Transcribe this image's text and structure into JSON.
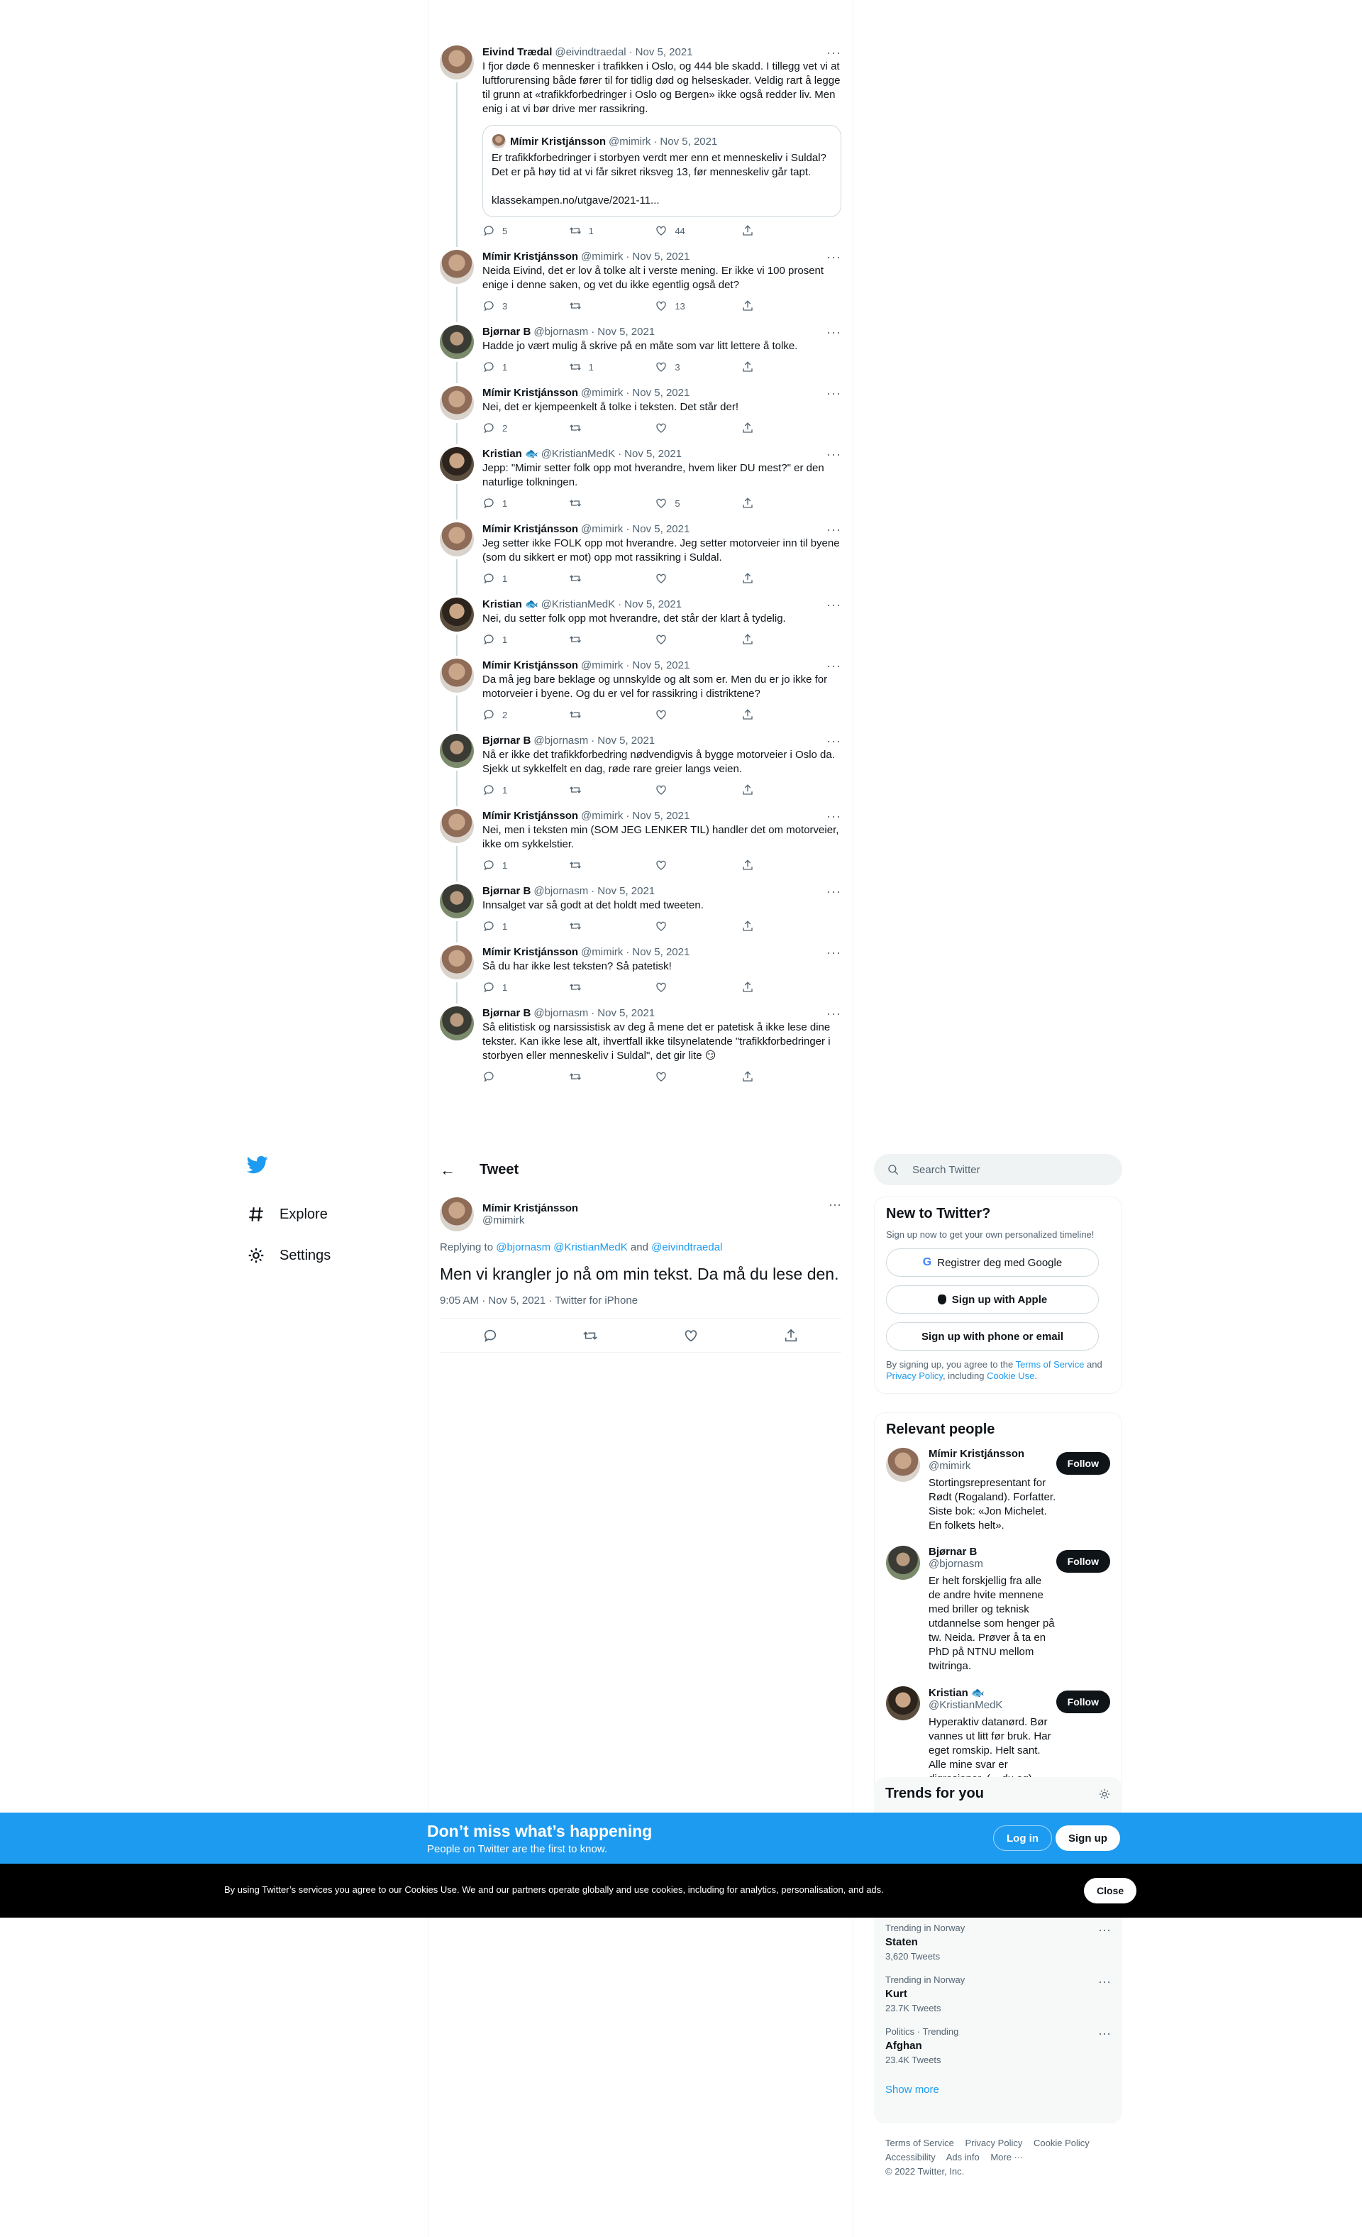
{
  "thread": [
    {
      "name": "Eivind Trædal",
      "handle": "@eivindtraedal",
      "date": "Nov 5, 2021",
      "text": "I fjor døde 6 mennesker i trafikken i Oslo, og 444 ble skadd. I tillegg vet vi at luftforurensing både fører til for tidlig død og helseskader. Veldig rart å legge til grunn at «trafikkforbedringer i Oslo og Bergen» ikke også redder liv. Men enig i at vi bør drive mer rassikring.",
      "quote": {
        "name": "Mímir Kristjánsson",
        "handle": "@mimirk",
        "date": "Nov 5, 2021",
        "text": "Er trafikkforbedringer i storbyen verdt mer enn et menneskeliv i Suldal? Det er på høy tid at vi får sikret riksveg 13, før menneskeliv går tapt.\n\nklassekampen.no/utgave/2021-11..."
      },
      "replies": "5",
      "retweets": "1",
      "likes": "44"
    },
    {
      "name": "Mímir Kristjánsson",
      "handle": "@mimirk",
      "date": "Nov 5, 2021",
      "text": "Neida Eivind, det er lov å tolke alt i verste mening. Er ikke vi 100 prosent enige i denne saken, og vet du ikke egentlig også det?",
      "replies": "3",
      "retweets": "",
      "likes": "13"
    },
    {
      "name": "Bjørnar B",
      "handle": "@bjornasm",
      "date": "Nov 5, 2021",
      "text": "Hadde jo vært mulig å skrive på en måte som var litt lettere å tolke.",
      "replies": "1",
      "retweets": "1",
      "likes": "3"
    },
    {
      "name": "Mímir Kristjánsson",
      "handle": "@mimirk",
      "date": "Nov 5, 2021",
      "text": "Nei, det er kjempeenkelt å tolke i teksten. Det står der!",
      "replies": "2",
      "retweets": "",
      "likes": ""
    },
    {
      "name": "Kristian 🐟",
      "handle": "@KristianMedK",
      "date": "Nov 5, 2021",
      "text": "Jepp: \"Mimir setter folk opp mot hverandre, hvem liker DU mest?\" er den naturlige tolkningen.",
      "replies": "1",
      "retweets": "",
      "likes": "5"
    },
    {
      "name": "Mímir Kristjánsson",
      "handle": "@mimirk",
      "date": "Nov 5, 2021",
      "text": "Jeg setter ikke FOLK opp mot hverandre. Jeg setter motorveier inn til byene (som du sikkert er mot) opp mot rassikring i Suldal.",
      "replies": "1",
      "retweets": "",
      "likes": ""
    },
    {
      "name": "Kristian 🐟",
      "handle": "@KristianMedK",
      "date": "Nov 5, 2021",
      "text": "Nei, du setter folk opp mot hverandre, det står der klart å tydelig.",
      "replies": "1",
      "retweets": "",
      "likes": ""
    },
    {
      "name": "Mímir Kristjánsson",
      "handle": "@mimirk",
      "date": "Nov 5, 2021",
      "text": "Da må jeg bare beklage og unnskylde og alt som er. Men du er jo ikke for motorveier i byene. Og du er vel for rassikring i distriktene?",
      "replies": "2",
      "retweets": "",
      "likes": ""
    },
    {
      "name": "Bjørnar B",
      "handle": "@bjornasm",
      "date": "Nov 5, 2021",
      "text": "Nå er ikke det trafikkforbedring nødvendigvis å bygge motorveier i Oslo da. Sjekk ut sykkelfelt en dag, røde rare greier langs veien.",
      "replies": "1",
      "retweets": "",
      "likes": ""
    },
    {
      "name": "Mímir Kristjánsson",
      "handle": "@mimirk",
      "date": "Nov 5, 2021",
      "text": "Nei, men i teksten min (SOM JEG LENKER TIL) handler det om motorveier, ikke om sykkelstier.",
      "replies": "1",
      "retweets": "",
      "likes": ""
    },
    {
      "name": "Bjørnar B",
      "handle": "@bjornasm",
      "date": "Nov 5, 2021",
      "text": "Innsalget var så godt at det holdt med tweeten.",
      "replies": "1",
      "retweets": "",
      "likes": ""
    },
    {
      "name": "Mímir Kristjánsson",
      "handle": "@mimirk",
      "date": "Nov 5, 2021",
      "text": "Så du har ikke lest teksten? Så patetisk!",
      "replies": "1",
      "retweets": "",
      "likes": ""
    },
    {
      "name": "Bjørnar B",
      "handle": "@bjornasm",
      "date": "Nov 5, 2021",
      "text": "Så elitistisk og narsissistisk av deg å mene det er patetisk å ikke lese dine tekster. Kan ikke lese alt, ihvertfall ikke tilsynelatende \"trafikkforbedringer i storbyen eller menneskeliv i Suldal\", det gir lite 😏",
      "replies": "",
      "retweets": "",
      "likes": ""
    }
  ],
  "nav": {
    "explore": "Explore",
    "settings": "Settings"
  },
  "focus": {
    "header": "Tweet",
    "name": "Mímir Kristjánsson",
    "handle": "@mimirk",
    "replying_prefix": "Replying to ",
    "replying_to": "@bjornasm @KristianMedK",
    "replying_and": " and ",
    "replying_last": "@eivindtraedal",
    "text": "Men vi krangler jo nå om min tekst. Da må du lese den.",
    "meta": "9:05 AM · Nov 5, 2021 · Twitter for iPhone"
  },
  "search": {
    "placeholder": "Search Twitter"
  },
  "new_to_twitter": {
    "title": "New to Twitter?",
    "subtitle": "Sign up now to get your own personalized timeline!",
    "google": "Registrer deg med Google",
    "apple": "Sign up with Apple",
    "phone": "Sign up with phone or email",
    "terms_1": "By signing up, you agree to the ",
    "terms_link1": "Terms of Service",
    "terms_2": " and ",
    "terms_link2": "Privacy Policy",
    "terms_3": ", including ",
    "terms_link3": "Cookie Use",
    "terms_4": "."
  },
  "relevant": {
    "title": "Relevant people",
    "follow": "Follow",
    "people": [
      {
        "name": "Mímir Kristjánsson",
        "handle": "@mimirk",
        "bio": "Stortingsrepresentant for Rødt (Rogaland). Forfatter. Siste bok: «Jon Michelet. En folkets helt»."
      },
      {
        "name": "Bjørnar B",
        "handle": "@bjornasm",
        "bio": "Er helt forskjellig fra alle de andre hvite mennene med briller og teknisk utdannelse som henger på tw. Neida. Prøver å ta en PhD på NTNU mellom twitringa."
      },
      {
        "name": "Kristian 🐟",
        "handle": "@KristianMedK",
        "bio": "Hyperaktiv datanørd. Bør vannes ut litt før bruk. Har eget romskip. Helt sant. Alle mine svar er digresjoner. (... du og)"
      }
    ]
  },
  "trends": {
    "title": "Trends for you",
    "items": [
      {
        "context": "Trending in Norway",
        "name": "Staten",
        "count": "3,620 Tweets"
      },
      {
        "context": "Trending in Norway",
        "name": "Kurt",
        "count": "23.7K Tweets"
      },
      {
        "context": "Politics · Trending",
        "name": "Afghan",
        "count": "23.4K Tweets"
      }
    ],
    "show_more": "Show more"
  },
  "footer": {
    "links_row1": [
      "Terms of Service",
      "Privacy Policy",
      "Cookie Policy"
    ],
    "links_row2": [
      "Accessibility",
      "Ads info",
      "More ···"
    ],
    "copyright": "© 2022 Twitter, Inc."
  },
  "banner": {
    "title": "Don’t miss what’s happening",
    "subtitle": "People on Twitter are the first to know.",
    "login": "Log in",
    "signup": "Sign up"
  },
  "cookie": {
    "text": "By using Twitter’s services you agree to our Cookies Use. We and our partners operate globally and use cookies, including for analytics, personalisation, and ads.",
    "close": "Close"
  },
  "colors": {
    "accent": "#1d9bf0",
    "text": "#0f1419",
    "muted": "#536471",
    "border": "#eff3f4"
  },
  "icons": [
    "twitter-logo-icon",
    "hashtag-icon",
    "gear-icon",
    "reply-icon",
    "retweet-icon",
    "like-icon",
    "share-icon",
    "back-arrow-icon",
    "search-icon",
    "google-icon",
    "apple-icon"
  ]
}
